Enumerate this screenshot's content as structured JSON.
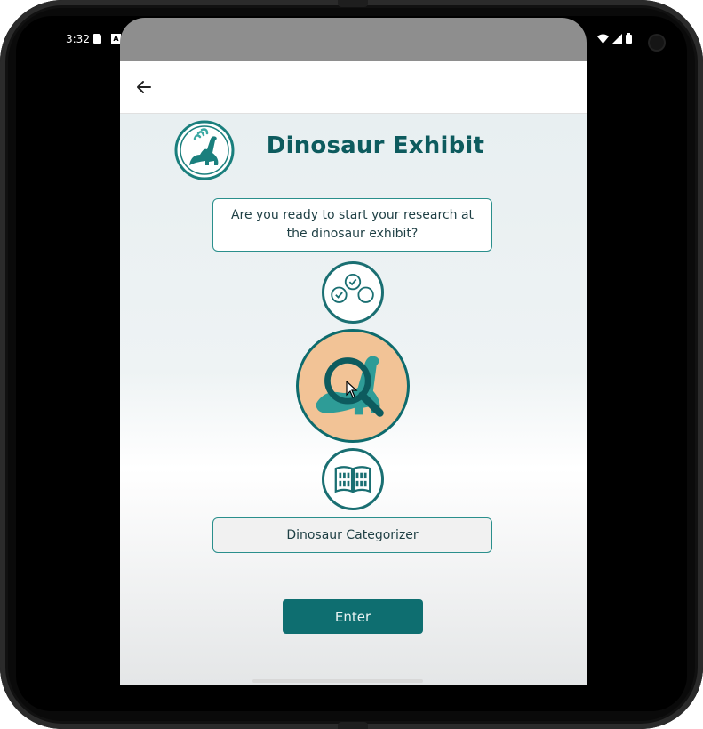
{
  "status_bar": {
    "time": "3:32",
    "notification_a": "A"
  },
  "app": {
    "title": "Dinosaur Exhibit",
    "question": "Are you ready to start your research at the dinosaur exhibit?",
    "selected_option": "Dinosaur Categorizer",
    "enter_label": "Enter",
    "options": [
      {
        "icon": "checklist-circles-icon"
      },
      {
        "icon": "magnifier-dinosaur-icon",
        "selected": true
      },
      {
        "icon": "open-book-icon"
      }
    ]
  },
  "colors": {
    "primary": "#0e6e70",
    "title": "#0d5b5e",
    "accent_fill": "#f2c396",
    "border": "#2a8f8c"
  }
}
